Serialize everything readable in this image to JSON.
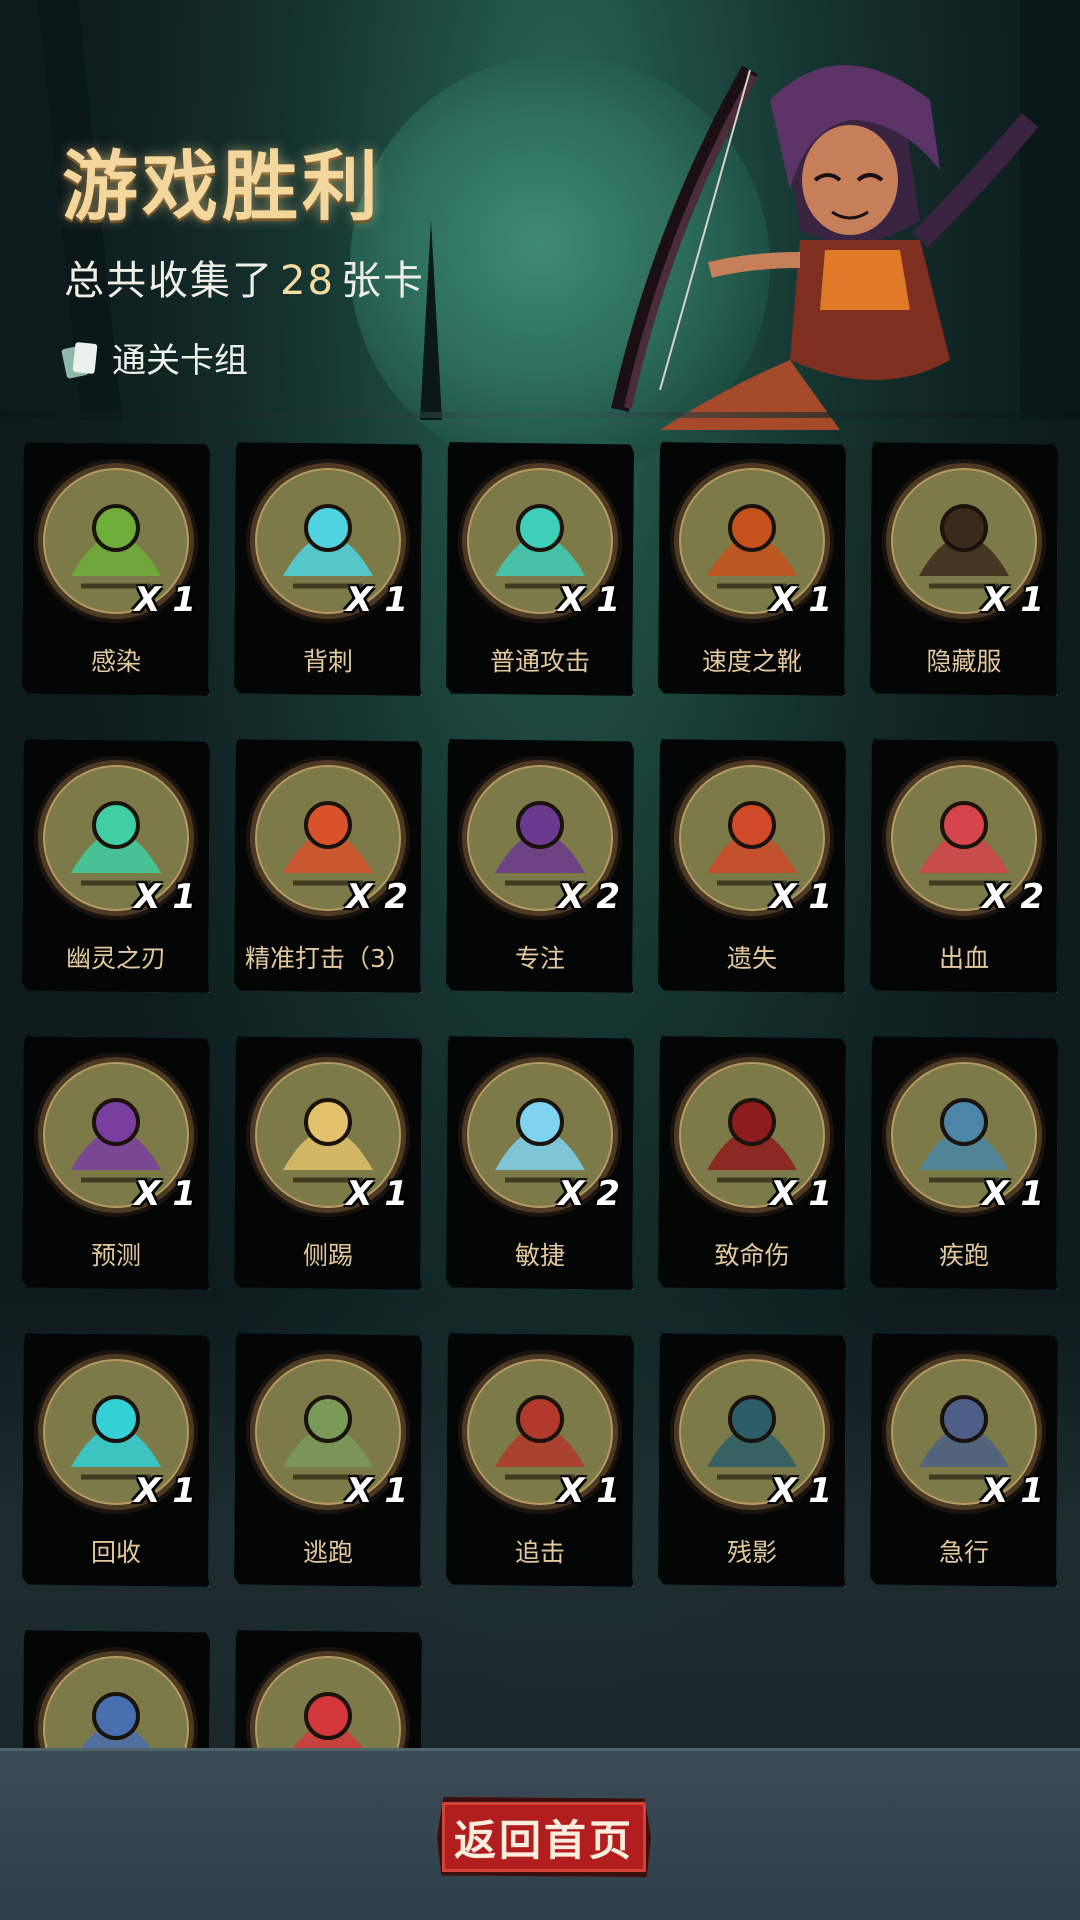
{
  "header": {
    "title": "游戏胜利",
    "subtitle_prefix": "总共收集了",
    "subtitle_count": "28",
    "subtitle_suffix": "张卡",
    "deck_link": "通关卡组"
  },
  "colors": {
    "title_gold": "#f3d79c",
    "card_label": "#e3c79d",
    "card_glow": "#5ac8b4",
    "medal_face": "#7b7a48",
    "medal_rim": "#4c3a24",
    "button_red": "#b21e1d"
  },
  "cards": [
    {
      "name": "感染",
      "qty": "X 1",
      "icon": "zombie-icon",
      "accent": "#6fae3a"
    },
    {
      "name": "背刺",
      "qty": "X 1",
      "icon": "backstab-icon",
      "accent": "#4fd3e0"
    },
    {
      "name": "普通攻击",
      "qty": "X 1",
      "icon": "spear-icon",
      "accent": "#3fcfb9"
    },
    {
      "name": "速度之靴",
      "qty": "X 1",
      "icon": "boot-icon",
      "accent": "#c8521c"
    },
    {
      "name": "隐藏服",
      "qty": "X 1",
      "icon": "cloak-icon",
      "accent": "#3a2a1c"
    },
    {
      "name": "幽灵之刃",
      "qty": "X 1",
      "icon": "ghost-blade-icon",
      "accent": "#3fcfa3"
    },
    {
      "name": "精准打击（3）",
      "qty": "X 2",
      "icon": "target-icon",
      "accent": "#d8532c"
    },
    {
      "name": "专注",
      "qty": "X 2",
      "icon": "wizard-icon",
      "accent": "#6b3a8f"
    },
    {
      "name": "遗失",
      "qty": "X 1",
      "icon": "thief-icon",
      "accent": "#d04a2a"
    },
    {
      "name": "出血",
      "qty": "X 2",
      "icon": "tentacle-icon",
      "accent": "#d6454b"
    },
    {
      "name": "预测",
      "qty": "X 1",
      "icon": "witch-icon",
      "accent": "#7a3ea0"
    },
    {
      "name": "侧踢",
      "qty": "X 1",
      "icon": "kick-icon",
      "accent": "#e3c26b"
    },
    {
      "name": "敏捷",
      "qty": "X 2",
      "icon": "panther-icon",
      "accent": "#7fd3f0"
    },
    {
      "name": "致命伤",
      "qty": "X 1",
      "icon": "bleeding-dagger-icon",
      "accent": "#8e1c1c"
    },
    {
      "name": "疾跑",
      "qty": "X 1",
      "icon": "runner-icon",
      "accent": "#4b86a6"
    },
    {
      "name": "回收",
      "qty": "X 1",
      "icon": "boomerang-icon",
      "accent": "#33d0d6"
    },
    {
      "name": "逃跑",
      "qty": "X 1",
      "icon": "flee-icon",
      "accent": "#7a9a5a"
    },
    {
      "name": "追击",
      "qty": "X 1",
      "icon": "pursuit-icon",
      "accent": "#b23a2c"
    },
    {
      "name": "残影",
      "qty": "X 1",
      "icon": "afterimage-icon",
      "accent": "#2c5d68"
    },
    {
      "name": "急行",
      "qty": "X 1",
      "icon": "march-icon",
      "accent": "#4d5f86"
    },
    {
      "name": "",
      "qty": "",
      "icon": "goblin-icon",
      "accent": "#4a6fb0"
    },
    {
      "name": "",
      "qty": "",
      "icon": "heart-cross-icon",
      "accent": "#d2383c"
    }
  ],
  "footer": {
    "back_button": "返回首页"
  }
}
